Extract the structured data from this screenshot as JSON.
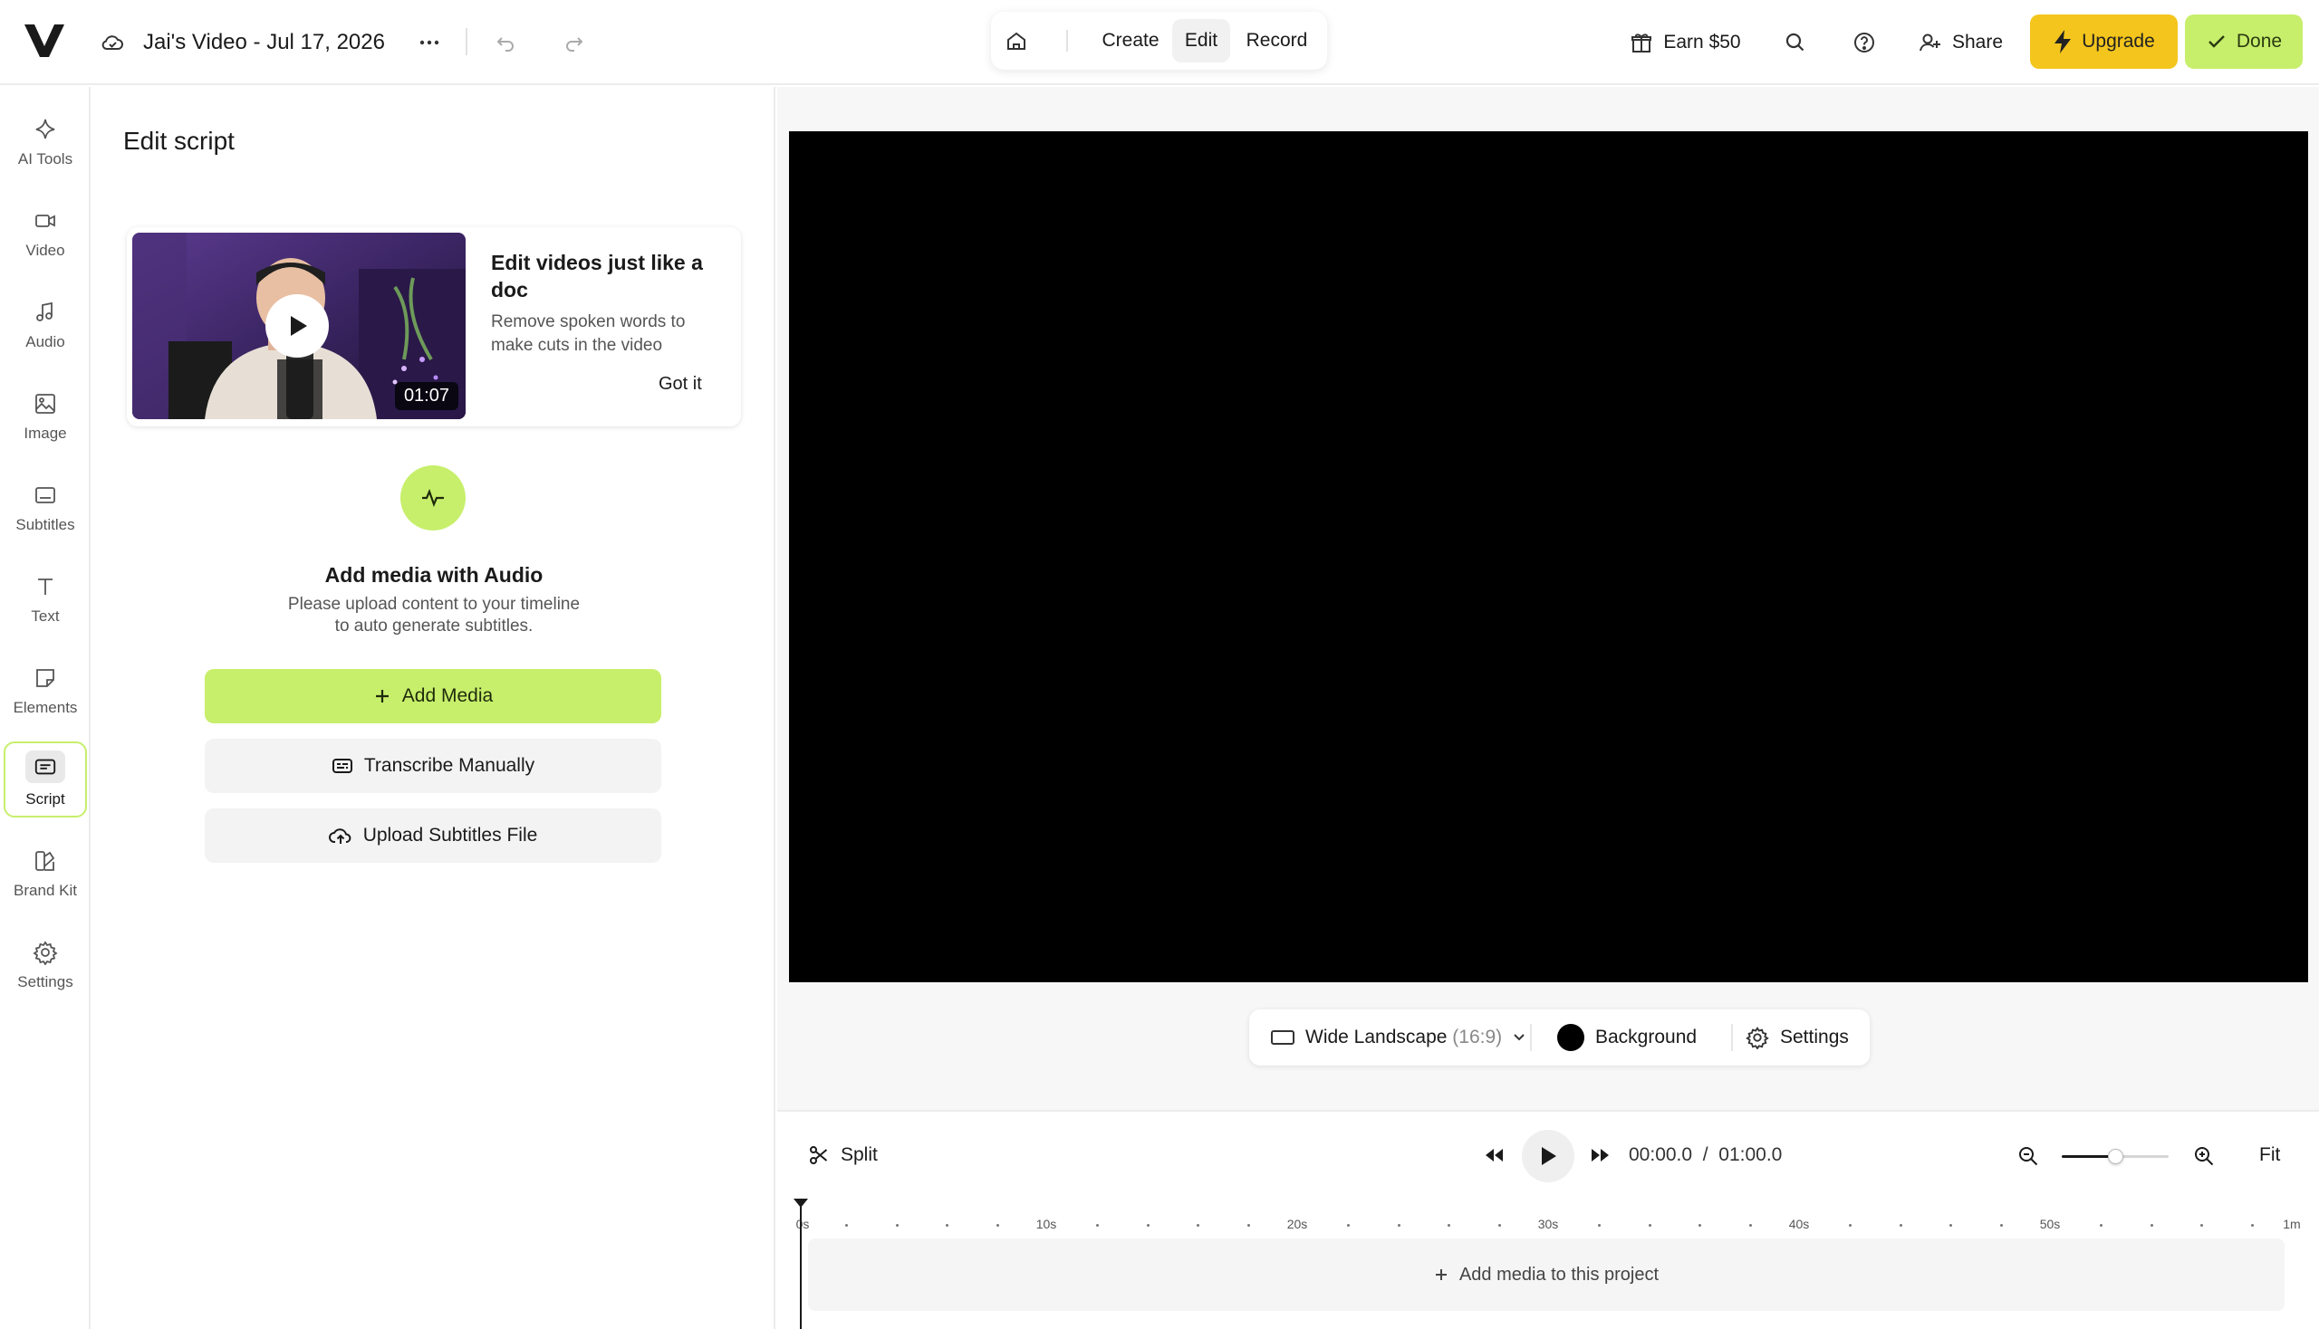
{
  "header": {
    "project_title": "Jai's Video - Jul 17, 2026",
    "modes": [
      {
        "label": "Create",
        "active": false
      },
      {
        "label": "Edit",
        "active": true
      },
      {
        "label": "Record",
        "active": false
      }
    ],
    "earn_label": "Earn $50",
    "share_label": "Share",
    "upgrade_label": "Upgrade",
    "done_label": "Done"
  },
  "sidebar": {
    "items": [
      {
        "label": "AI Tools",
        "icon": "sparkle-icon"
      },
      {
        "label": "Video",
        "icon": "video-camera-icon"
      },
      {
        "label": "Audio",
        "icon": "music-note-icon"
      },
      {
        "label": "Image",
        "icon": "image-icon"
      },
      {
        "label": "Subtitles",
        "icon": "subtitles-icon"
      },
      {
        "label": "Text",
        "icon": "text-icon"
      },
      {
        "label": "Elements",
        "icon": "sticker-icon"
      },
      {
        "label": "Script",
        "icon": "script-icon",
        "active": true
      },
      {
        "label": "Brand Kit",
        "icon": "brand-kit-icon"
      },
      {
        "label": "Settings",
        "icon": "gear-icon"
      }
    ]
  },
  "panel": {
    "title": "Edit script",
    "tip": {
      "title": "Edit videos just like a doc",
      "description": "Remove spoken words to make cuts in the video",
      "dismiss": "Got it",
      "duration": "01:07"
    },
    "empty_state": {
      "title": "Add media with Audio",
      "description_line1": "Please upload content to your timeline",
      "description_line2": "to auto generate subtitles."
    },
    "buttons": {
      "add_media": "Add Media",
      "transcribe": "Transcribe Manually",
      "upload_subtitles": "Upload Subtitles File"
    }
  },
  "canvas_bar": {
    "aspect_label": "Wide Landscape",
    "aspect_ratio": "(16:9)",
    "background_label": "Background",
    "background_color": "#000000",
    "settings_label": "Settings"
  },
  "timeline": {
    "split_label": "Split",
    "current_time": "00:00.0",
    "separator": "/",
    "total_time": "01:00.0",
    "zoom_level": 0.5,
    "fit_label": "Fit",
    "ruler_labels": [
      "0s",
      "10s",
      "20s",
      "30s",
      "40s",
      "50s",
      "1m"
    ],
    "track_empty": "Add media to this project"
  },
  "colors": {
    "accent_green": "#c7ef6b",
    "upgrade_yellow": "#f4c51c"
  }
}
